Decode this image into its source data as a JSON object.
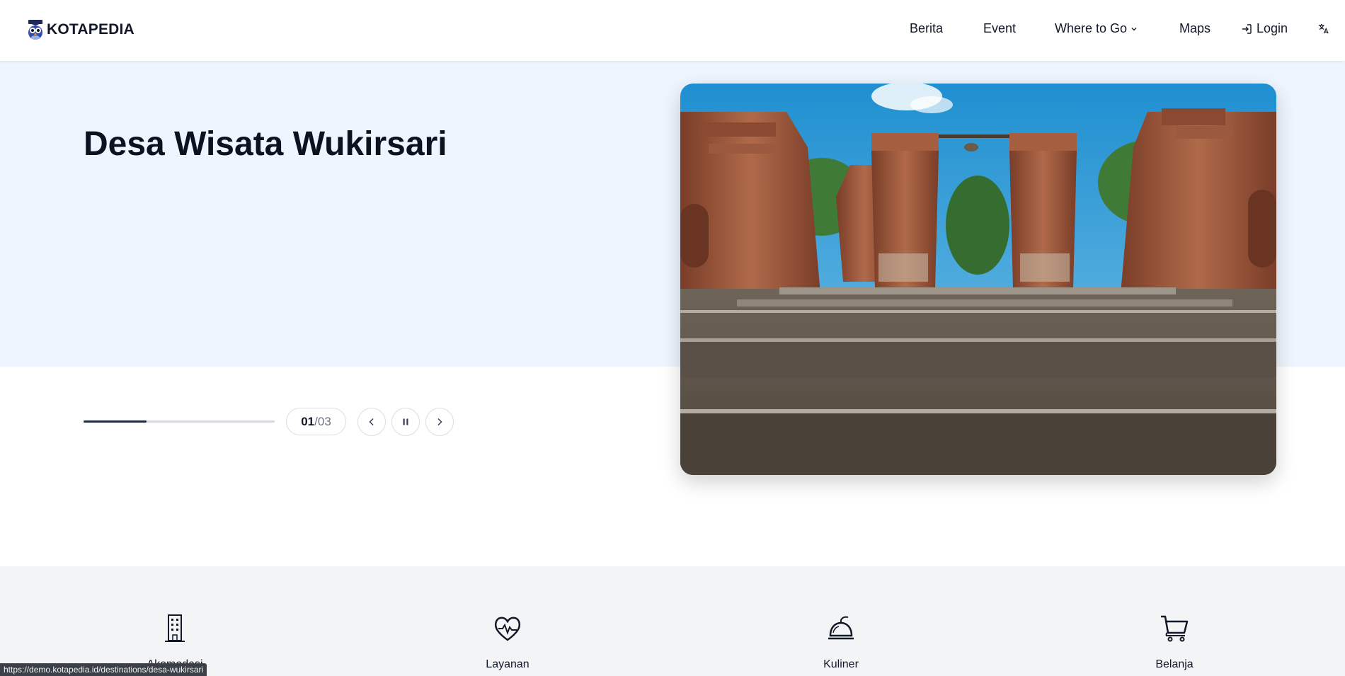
{
  "brand": {
    "name": "KOTAPEDIA"
  },
  "nav": {
    "items": [
      {
        "label": "Berita"
      },
      {
        "label": "Event"
      },
      {
        "label": "Where to Go"
      },
      {
        "label": "Maps"
      },
      {
        "label": "Login"
      }
    ],
    "translate_icon": "translate-icon"
  },
  "hero": {
    "title": "Desa Wisata Wukirsari",
    "slide_current": "01",
    "slide_separator_total": "/03",
    "progress_fraction": 0.33,
    "image_alt_icon": "temple-stairs-photo"
  },
  "categories": [
    {
      "label": "Akomodasi",
      "icon": "building-icon"
    },
    {
      "label": "Layanan",
      "icon": "heart-pulse-icon"
    },
    {
      "label": "Kuliner",
      "icon": "food-cloche-icon"
    },
    {
      "label": "Belanja",
      "icon": "shopping-cart-icon"
    }
  ],
  "status_bar": {
    "url": "https://demo.kotapedia.id/destinations/desa-wukirsari"
  },
  "colors": {
    "hero_bg": "#eef5fe",
    "accent": "#1f2a44",
    "section_bg": "#f3f4f6"
  }
}
